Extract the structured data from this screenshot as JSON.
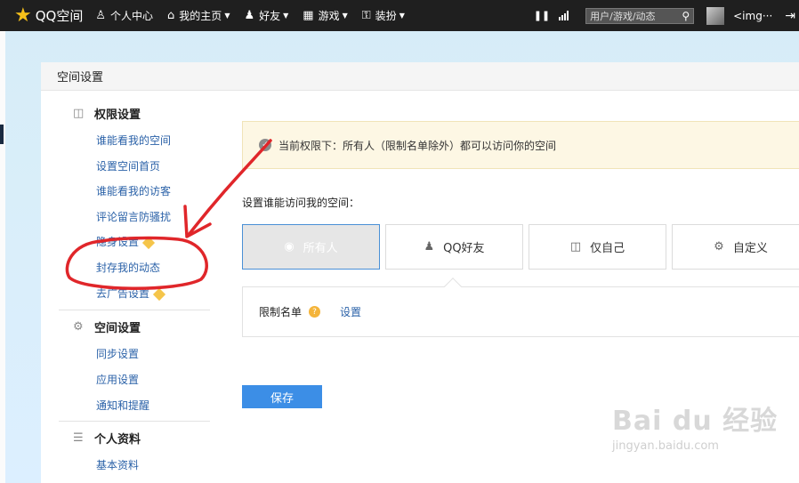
{
  "topbar": {
    "logo_text": "QQ空间",
    "nav": [
      {
        "label": "个人中心",
        "icon": "user-icon",
        "caret": false
      },
      {
        "label": "我的主页",
        "icon": "home-icon",
        "caret": true
      },
      {
        "label": "好友",
        "icon": "friends-icon",
        "caret": true
      },
      {
        "label": "游戏",
        "icon": "games-grid-icon",
        "caret": true
      },
      {
        "label": "装扮",
        "icon": "shirt-icon",
        "caret": true
      }
    ],
    "search_placeholder": "用户/游戏/动态",
    "username": "<img···"
  },
  "panel": {
    "title": "空间设置",
    "sidebar": {
      "sections": [
        {
          "title": "权限设置",
          "icon": "lock-icon",
          "items": [
            "谁能看我的空间",
            "设置空间首页",
            "谁能看我的访客",
            "评论留言防骚扰",
            "隐身设置",
            "封存我的动态",
            "去广告设置"
          ]
        },
        {
          "title": "空间设置",
          "icon": "settings-tag-icon",
          "items": [
            "同步设置",
            "应用设置",
            "通知和提醒"
          ]
        },
        {
          "title": "个人资料",
          "icon": "profile-card-icon",
          "items": [
            "基本资料"
          ]
        }
      ]
    },
    "main": {
      "notice": "当前权限下：所有人（限制名单除外）都可以访问你的空间",
      "who_label": "设置谁能访问我的空间：",
      "options": [
        {
          "label": "所有人",
          "icon": "globe-icon",
          "selected": true
        },
        {
          "label": "QQ好友",
          "icon": "friends-icon",
          "selected": false
        },
        {
          "label": "仅自己",
          "icon": "lock-icon",
          "selected": false
        },
        {
          "label": "自定义",
          "icon": "gear-icon",
          "selected": false
        }
      ],
      "limit_label": "限制名单",
      "limit_link": "设置",
      "save_label": "保存"
    }
  },
  "watermark": {
    "line1": "Bai du 经验",
    "line2": "jingyan.baidu.com"
  },
  "colors": {
    "accent": "#3c8ee6",
    "link": "#2b62a8",
    "annotation": "#e0262a"
  }
}
